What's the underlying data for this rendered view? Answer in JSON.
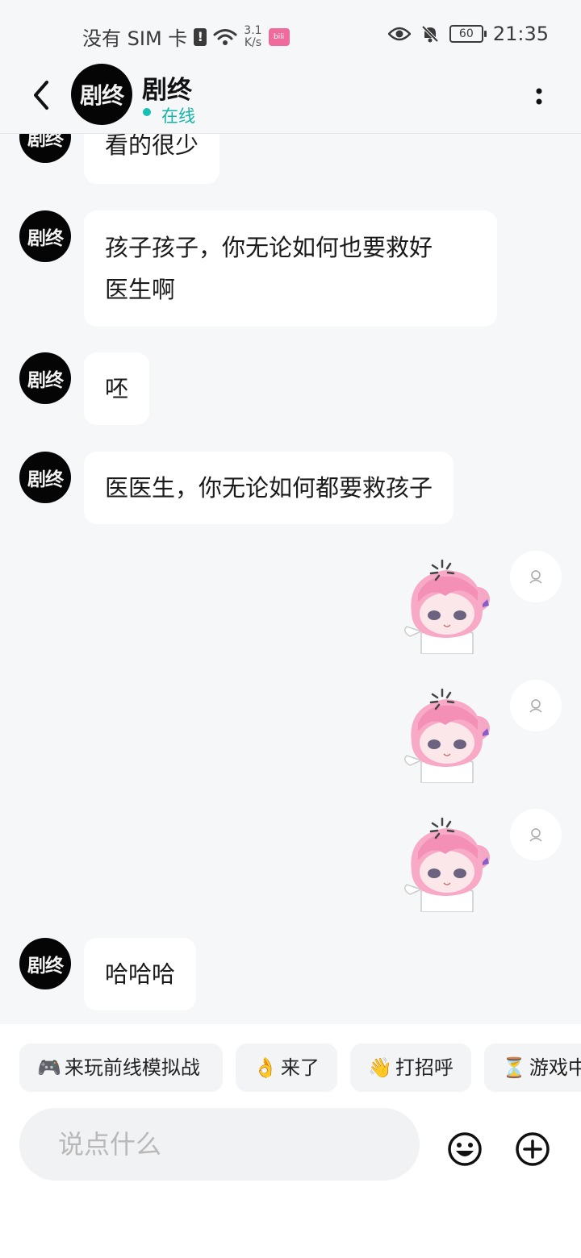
{
  "status_bar": {
    "carrier": "没有 SIM 卡",
    "net_speed_value": "3.1",
    "net_speed_unit": "K/s",
    "battery": "60",
    "time": "21:35"
  },
  "header": {
    "avatar_text": "剧终",
    "name": "剧终",
    "status": "在线"
  },
  "messages": [
    {
      "avatar_text": "剧终",
      "text": "看的很少"
    },
    {
      "avatar_text": "剧终",
      "text_line1": "孩子孩子，你无论如何也要救好",
      "text_line2": "医生啊"
    },
    {
      "avatar_text": "剧终",
      "text": "呸"
    },
    {
      "avatar_text": "剧终",
      "text": "医医生，你无论如何都要救孩子"
    },
    {
      "avatar_text": "剧终",
      "text": "哈哈哈"
    }
  ],
  "quick_replies": [
    {
      "emoji": "🎮",
      "label": "来玩前线模拟战"
    },
    {
      "emoji": "👌",
      "label": "来了"
    },
    {
      "emoji": "👋",
      "label": "打招呼"
    },
    {
      "emoji": "⏳",
      "label": "游戏中"
    }
  ],
  "input": {
    "placeholder": "说点什么"
  },
  "colors": {
    "online": "#13c2b3",
    "background": "#f6f7f9",
    "bubble": "#ffffff"
  }
}
